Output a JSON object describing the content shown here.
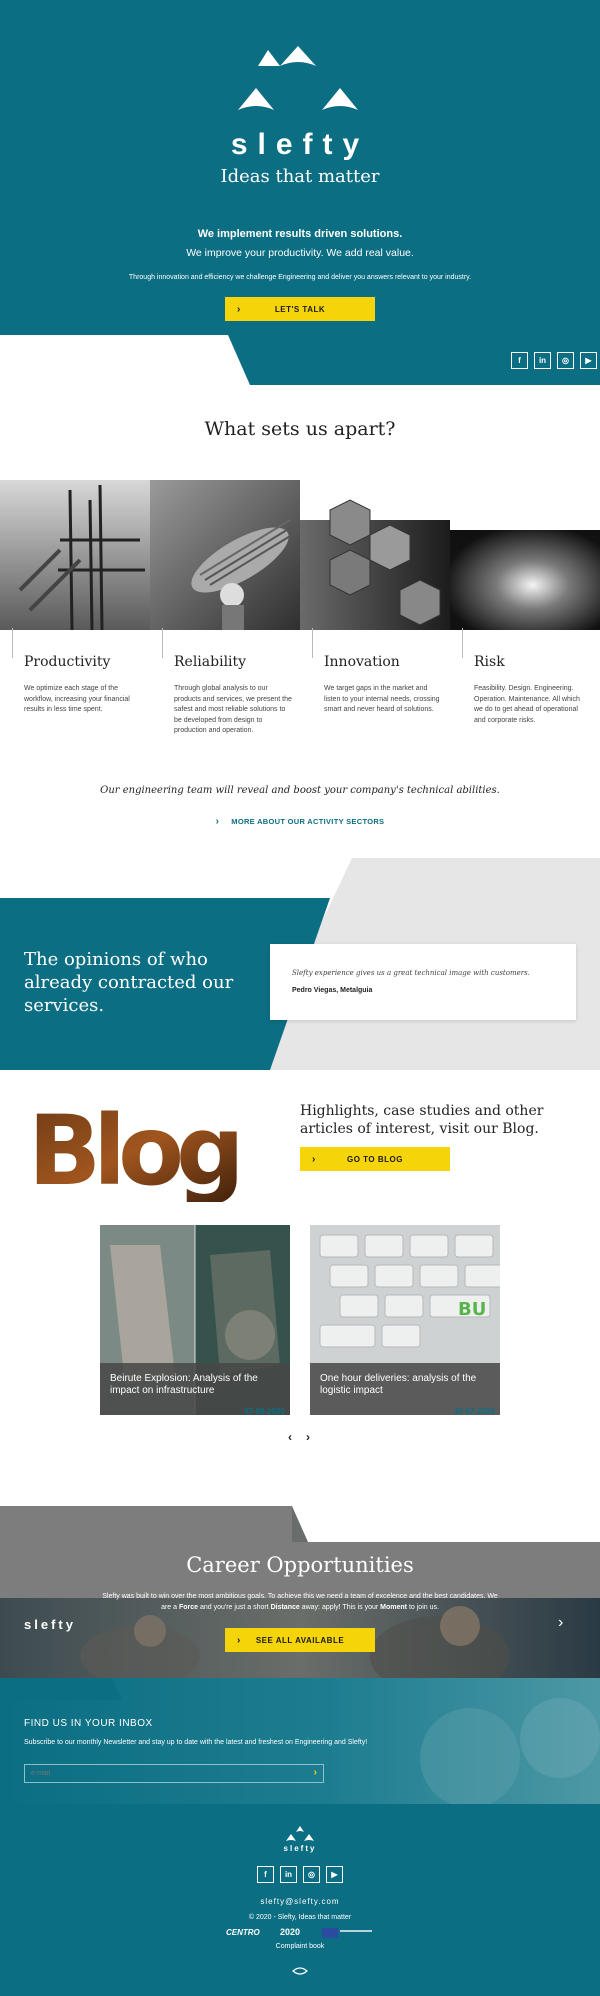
{
  "colors": {
    "teal": "#0c6e83",
    "yellow": "#f5d50a",
    "grey": "#e6e6e6",
    "dark_grey": "#5a5a5a"
  },
  "hero": {
    "brand": "slefty",
    "tagline": "Ideas that matter",
    "headline": "We implement results driven solutions.",
    "subheadline": "We improve your productivity. We add real value.",
    "body": "Through innovation and efficiency we challenge Engineering and deliver you answers relevant to your industry.",
    "cta_label": "LET'S TALK",
    "social": [
      {
        "icon": "facebook-icon",
        "glyph": "f"
      },
      {
        "icon": "linkedin-icon",
        "glyph": "in"
      },
      {
        "icon": "instagram-icon",
        "glyph": "◎"
      },
      {
        "icon": "youtube-icon",
        "glyph": "▶"
      }
    ]
  },
  "apart": {
    "title": "What sets us apart?",
    "features": [
      {
        "title": "Productivity",
        "desc": "We optimize each stage of the workflow, increasing your financial results in less time spent."
      },
      {
        "title": "Reliability",
        "desc": "Through global analysis to our products and services, we present the safest and most reliable solutions to be developed from design to production and operation."
      },
      {
        "title": "Innovation",
        "desc": "We target gaps in the market and listen to your internal needs, crossing smart and never heard of solutions."
      },
      {
        "title": "Risk",
        "desc": "Feasibility. Design. Engineering. Operation. Maintenance. All which we do to get ahead of operational and corporate risks."
      }
    ],
    "statement": "Our engineering team will reveal and boost your company's technical abilities.",
    "link_label": "MORE ABOUT OUR ACTIVITY SECTORS"
  },
  "opinions": {
    "title": "The opinions of who already contracted our services.",
    "quote": "Slefty experience gives us a great technical image with customers.",
    "author": "Pedro Viegas, Metalguia"
  },
  "blog": {
    "logo_text": "Blog",
    "headline": "Highlights, case studies and other articles of interest, visit our Blog.",
    "cta_label": "GO TO BLOG",
    "posts": [
      {
        "title": "Beirute Explosion: Analysis of the impact on infrastructure",
        "date": "07-08-2020"
      },
      {
        "title": "One hour deliveries: analysis of the logistic impact",
        "date": "30-07-2020"
      }
    ],
    "prev": "‹",
    "next": "›"
  },
  "career": {
    "title": "Career Opportunities",
    "body_1": "Slefty was built to win over the most ambitious goals. To achieve this we need a team of excelence and the best candidates. We are a ",
    "bold_1": "Force",
    "body_2": " and you're just a short ",
    "bold_2": "Distance",
    "body_3": " away: apply! This is your ",
    "bold_3": "Moment",
    "body_4": " to join us.",
    "brand": "slefty",
    "cta_label": "SEE ALL AVAILABLE",
    "next": "›"
  },
  "newsletter": {
    "title": "FIND US IN YOUR INBOX",
    "body": "Subscribe to our monthly Newsletter and stay up to date with the latest and freshest on Engineering and Slefty!",
    "placeholder": "e-mail"
  },
  "footer": {
    "brand": "slefty",
    "email": "slefty@slefty.com",
    "copyright": "© 2020 - Slefty, Ideas that matter",
    "logo_centro": "CENTRO",
    "logo_portugal": "2020",
    "complaint": "Complaint book"
  }
}
